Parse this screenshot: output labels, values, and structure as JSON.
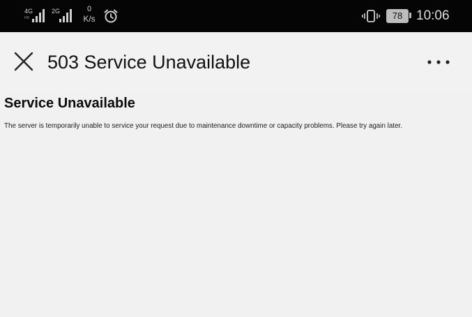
{
  "status_bar": {
    "signal_1": {
      "network": "4G",
      "sub": "HD",
      "level": 4
    },
    "signal_2": {
      "network": "2G",
      "level": 4
    },
    "speed_value": "0",
    "speed_unit": "K/s",
    "alarm": "alarm-clock-icon",
    "vibrate": "vibrate-icon",
    "battery_level": "78",
    "time": "10:06",
    "colors": {
      "background": "#050505",
      "foreground": "#d8d8d8"
    }
  },
  "app_bar": {
    "close_icon": "close-icon",
    "title": "503 Service Unavailable",
    "menu_icon": "more-options-icon"
  },
  "page": {
    "heading": "Service Unavailable",
    "message": "The server is temporarily unable to service your request due to maintenance downtime or capacity problems. Please try again later."
  }
}
